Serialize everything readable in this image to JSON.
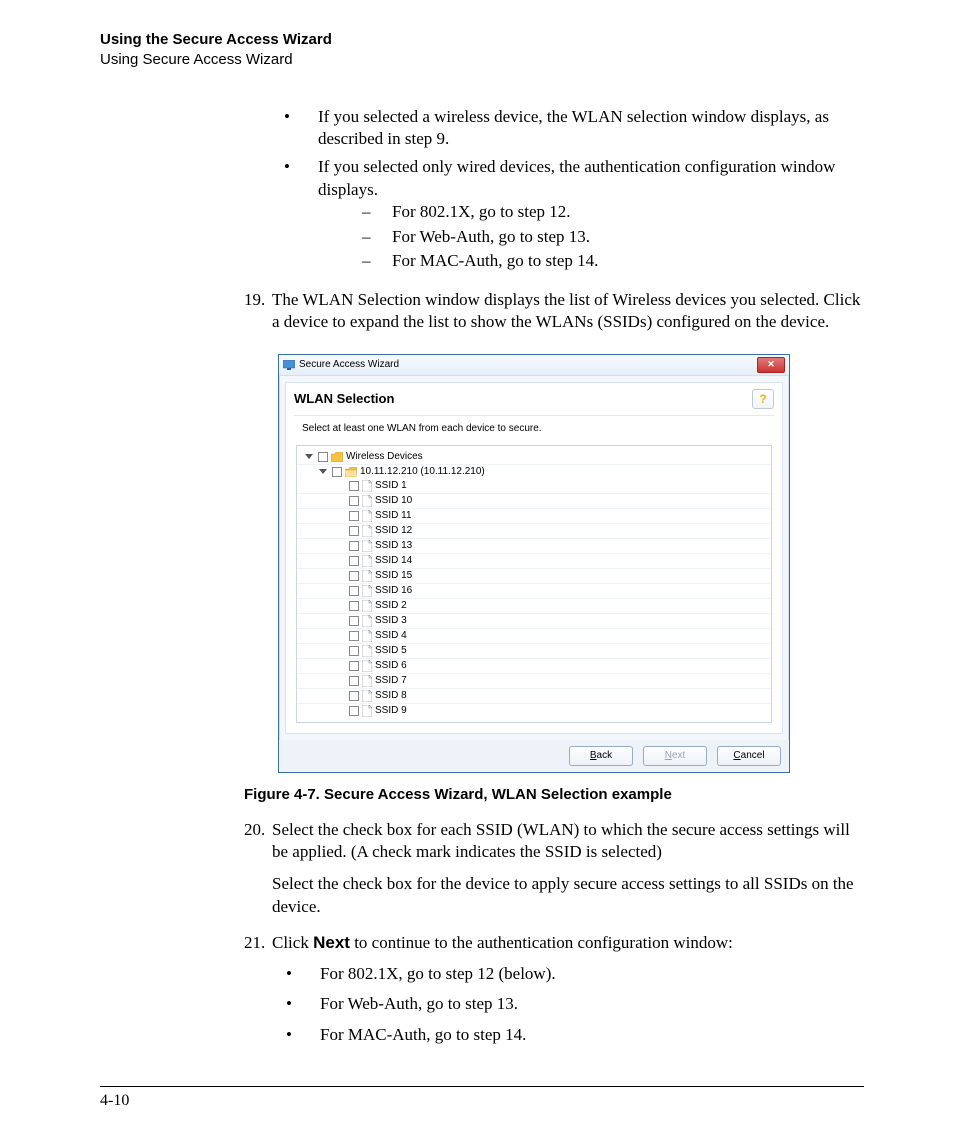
{
  "header": {
    "title": "Using the Secure Access Wizard",
    "subtitle": "Using Secure Access Wizard"
  },
  "bullets_top": [
    {
      "text": "If you selected a wireless device, the WLAN selection window displays, as described in step 9."
    },
    {
      "text": "If you selected only wired devices, the authentication configuration window displays.",
      "sub": [
        "For 802.1X, go to step 12.",
        "For Web-Auth, go to step 13.",
        "For MAC-Auth, go to step 14."
      ]
    }
  ],
  "step19": {
    "num": "19.",
    "text": "The WLAN Selection window displays the list of Wireless devices you selected. Click a device to expand the list to show the WLANs (SSIDs) configured on the device."
  },
  "wizard": {
    "window_title": "Secure Access Wizard",
    "heading": "WLAN Selection",
    "subtext": "Select at least one WLAN from each device to secure.",
    "root_label": "Wireless Devices",
    "device_label": "10.11.12.210 (10.11.12.210)",
    "ssids": [
      "SSID 1",
      "SSID 10",
      "SSID 11",
      "SSID 12",
      "SSID 13",
      "SSID 14",
      "SSID 15",
      "SSID 16",
      "SSID 2",
      "SSID 3",
      "SSID 4",
      "SSID 5",
      "SSID 6",
      "SSID 7",
      "SSID 8",
      "SSID 9"
    ],
    "btn_back": "Back",
    "btn_next": "Next",
    "btn_cancel": "Cancel"
  },
  "figure_caption": "Figure 4-7. Secure Access Wizard, WLAN Selection example",
  "step20": {
    "num": "20.",
    "p1": "Select the check box for each SSID (WLAN) to which the secure access settings will be applied. (A check mark indicates the SSID is selected)",
    "p2": "Select the check box for the device to apply secure access settings to all SSIDs on the device."
  },
  "step21": {
    "num": "21.",
    "pre": "Click ",
    "bold": "Next",
    "post": " to continue to the authentication configuration window:",
    "sub": [
      "For 802.1X, go to step 12 (below).",
      "For Web-Auth, go to step 13.",
      "For MAC-Auth, go to step 14."
    ]
  },
  "page_number": "4-10"
}
